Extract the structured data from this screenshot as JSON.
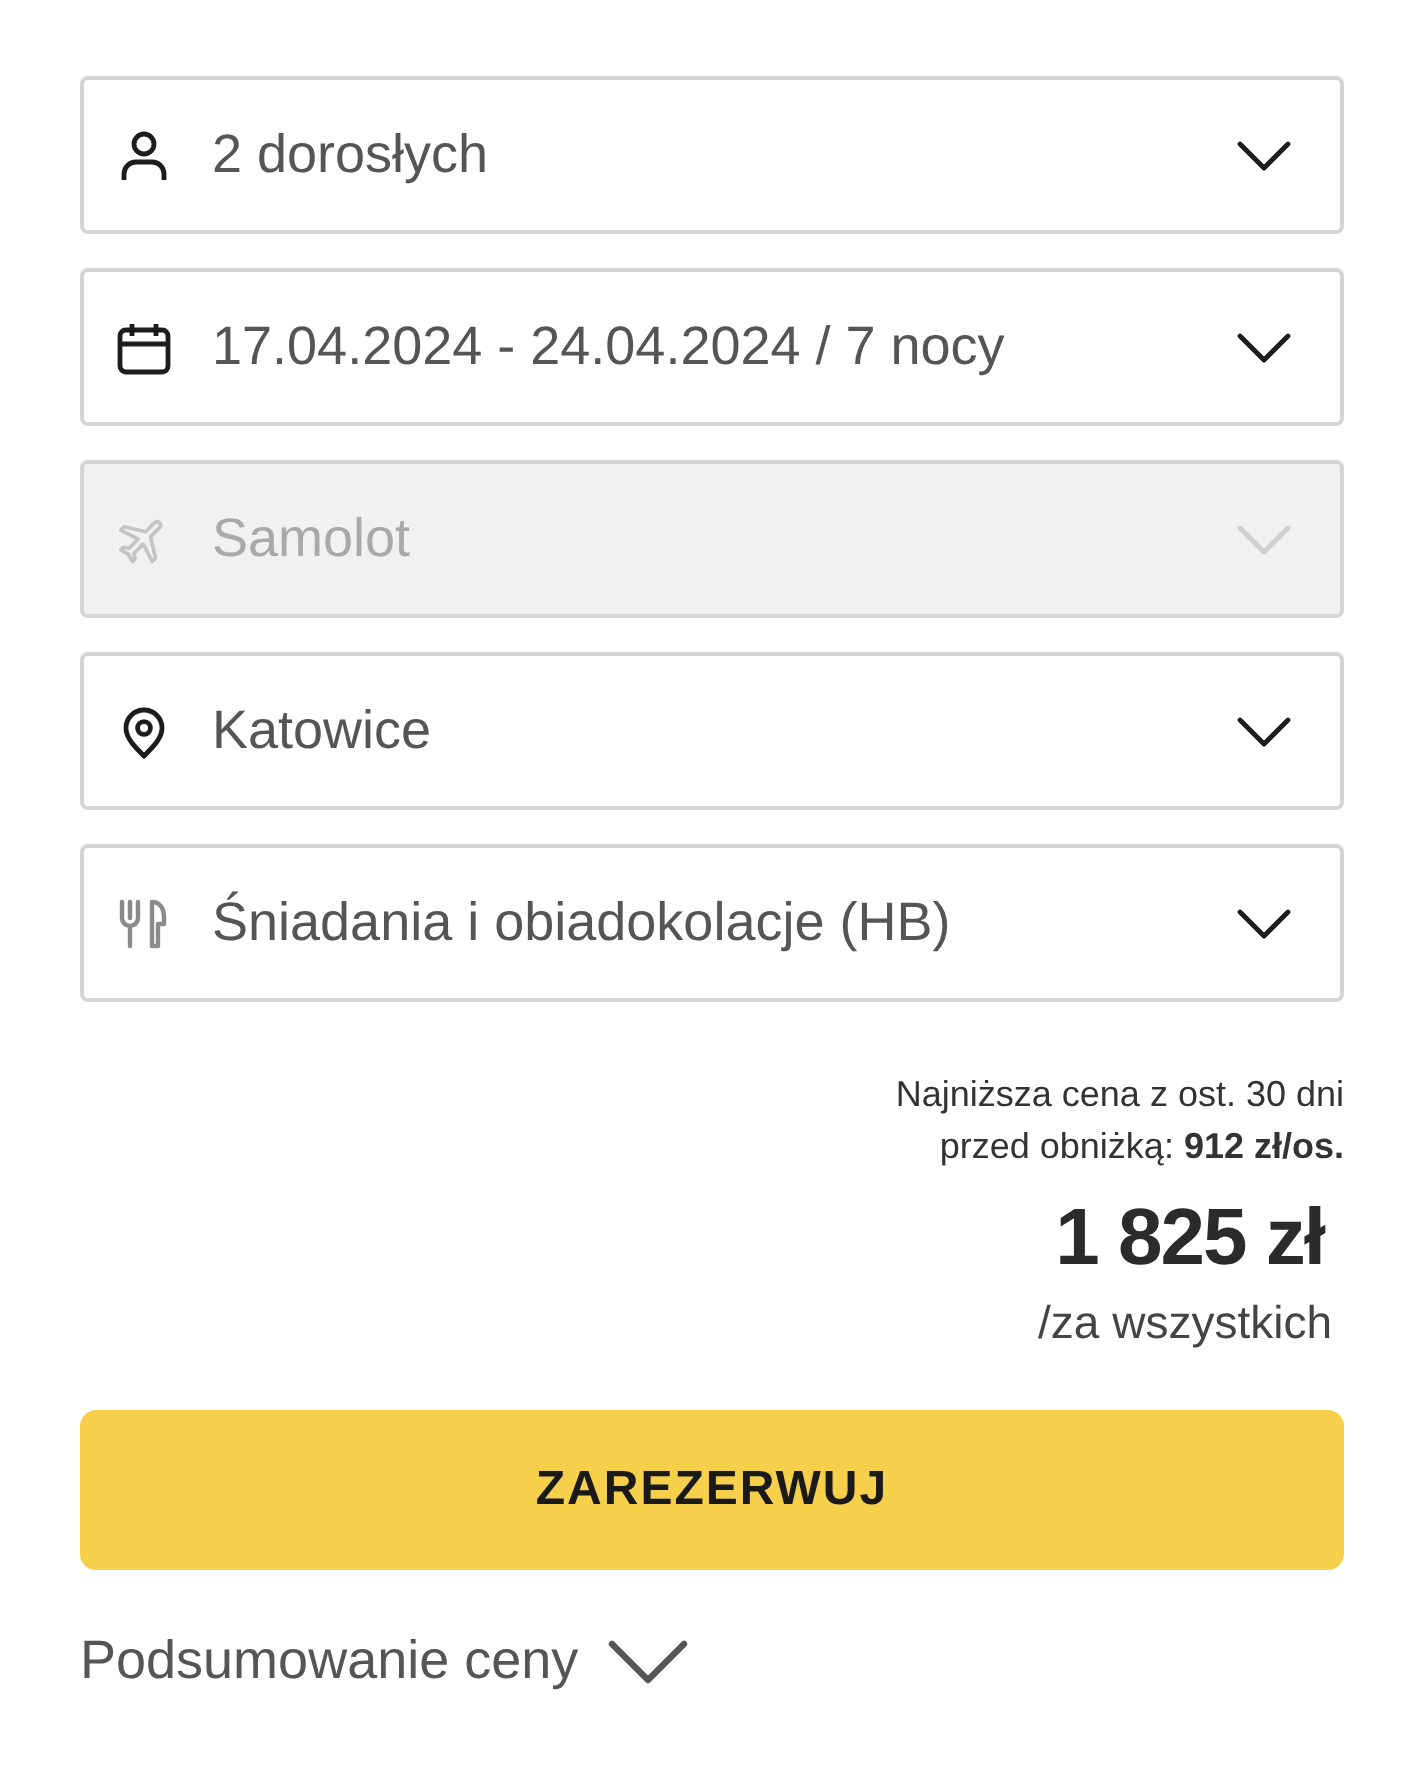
{
  "selects": [
    {
      "kind": "travelers",
      "value": "2 dorosłych",
      "disabled": false
    },
    {
      "kind": "dates",
      "value": "17.04.2024 - 24.04.2024 / 7 nocy",
      "disabled": false
    },
    {
      "kind": "transport",
      "value": "Samolot",
      "disabled": true
    },
    {
      "kind": "departure",
      "value": "Katowice",
      "disabled": false
    },
    {
      "kind": "board",
      "value": "Śniadania i obiadokolacje (HB)",
      "disabled": false
    }
  ],
  "price": {
    "lowest_note": "Najniższa cena z ost. 30 dni przed obniżką: **912 zł/os.**",
    "total": "1 825 zł",
    "per": "/za wszystkich"
  },
  "book_button": "ZAREZERWUJ",
  "summary_toggle": {
    "label": "Podsumowanie ceny",
    "expanded": false
  }
}
